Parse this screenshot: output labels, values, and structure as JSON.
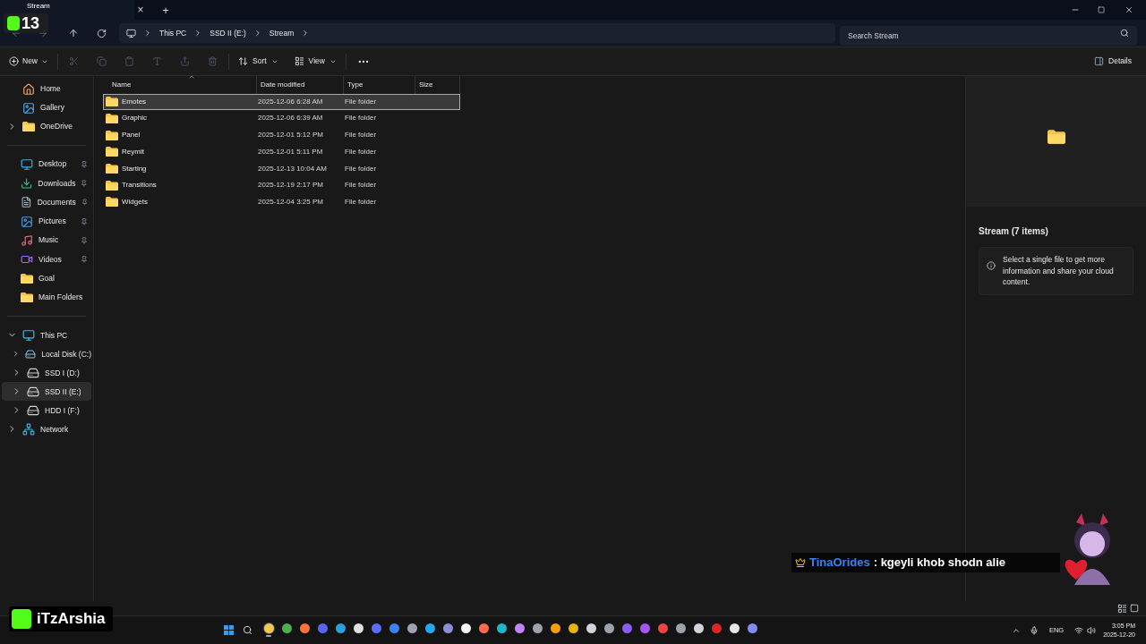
{
  "overlay": {
    "logo_number": "13",
    "streamer": "iTzArshia",
    "chat": {
      "user": "TinaOrides",
      "message": ": kgeyli khob shodn alie"
    }
  },
  "tab": {
    "title": "Stream",
    "close": "×",
    "add": "+"
  },
  "breadcrumb": [
    "This PC",
    "SSD II (E:)",
    "Stream"
  ],
  "search": {
    "placeholder": "Search Stream"
  },
  "toolbar": {
    "new": "New",
    "sort": "Sort",
    "view": "View",
    "details": "Details"
  },
  "sidebar": {
    "top": [
      {
        "label": "Home"
      },
      {
        "label": "Gallery"
      },
      {
        "label": "OneDrive",
        "expanded": false
      }
    ],
    "quick": [
      {
        "label": "Desktop",
        "pinned": true
      },
      {
        "label": "Downloads",
        "pinned": true
      },
      {
        "label": "Documents",
        "pinned": true
      },
      {
        "label": "Pictures",
        "pinned": true
      },
      {
        "label": "Music",
        "pinned": true
      },
      {
        "label": "Videos",
        "pinned": true
      },
      {
        "label": "Goal",
        "pinned": false
      },
      {
        "label": "Main Folders",
        "pinned": false
      }
    ],
    "tree": [
      {
        "label": "This PC",
        "expanded": true,
        "selected": false,
        "children": [
          {
            "label": "Local Disk (C:)",
            "expanded": false,
            "selected": false
          },
          {
            "label": "SSD I (D:)",
            "expanded": false,
            "selected": false
          },
          {
            "label": "SSD II (E:)",
            "expanded": false,
            "selected": true
          },
          {
            "label": "HDD I (F:)",
            "expanded": false,
            "selected": false
          }
        ]
      },
      {
        "label": "Network",
        "expanded": false,
        "selected": false
      }
    ]
  },
  "columns": [
    "Name",
    "Date modified",
    "Type",
    "Size"
  ],
  "rows": [
    {
      "name": "Emotes",
      "date": "2025-12-06 6:28 AM",
      "type": "File folder",
      "selected": true
    },
    {
      "name": "Graphic",
      "date": "2025-12-06 6:39 AM",
      "type": "File folder",
      "selected": false
    },
    {
      "name": "Panel",
      "date": "2025-12-01 5:12 PM",
      "type": "File folder",
      "selected": false
    },
    {
      "name": "Reymit",
      "date": "2025-12-01 5:11 PM",
      "type": "File folder",
      "selected": false
    },
    {
      "name": "Starting",
      "date": "2025-12-13 10:04 AM",
      "type": "File folder",
      "selected": false
    },
    {
      "name": "Transitions",
      "date": "2025-12-19 2:17 PM",
      "type": "File folder",
      "selected": false
    },
    {
      "name": "Widgets",
      "date": "2025-12-04 3:25 PM",
      "type": "File folder",
      "selected": false
    }
  ],
  "details": {
    "title": "Stream (7 items)",
    "info": "Select a single file to get more information and share your cloud content."
  },
  "taskbar": {
    "apps": [
      {
        "color": "#f2c94c",
        "active": true
      },
      {
        "color": "#4caf50",
        "active": false
      },
      {
        "color": "#ff7139",
        "active": false
      },
      {
        "color": "#5865f2",
        "active": false
      },
      {
        "color": "#2aa1de",
        "active": false
      },
      {
        "color": "#e0e0e0",
        "active": false
      },
      {
        "color": "#5b6cff",
        "active": false
      },
      {
        "color": "#3b82f6",
        "active": false
      },
      {
        "color": "#9ca3af",
        "active": false
      },
      {
        "color": "#23a9f2",
        "active": false
      },
      {
        "color": "#8b8fd9",
        "active": false
      },
      {
        "color": "#f5f5f5",
        "active": false
      },
      {
        "color": "#ff6b4a",
        "active": false
      },
      {
        "color": "#1fb6c9",
        "active": false
      },
      {
        "color": "#c084fc",
        "active": false
      },
      {
        "color": "#9ca3af",
        "active": false
      },
      {
        "color": "#f59e0b",
        "active": false
      },
      {
        "color": "#eab308",
        "active": false
      },
      {
        "color": "#d1d5db",
        "active": false
      },
      {
        "color": "#9ca3af",
        "active": false
      },
      {
        "color": "#8b5cf6",
        "active": false
      },
      {
        "color": "#a855f7",
        "active": false
      },
      {
        "color": "#ef4444",
        "active": false
      },
      {
        "color": "#9ca3af",
        "active": false
      },
      {
        "color": "#d1d5db",
        "active": false
      },
      {
        "color": "#dc2626",
        "active": false
      },
      {
        "color": "#e5e7eb",
        "active": false
      },
      {
        "color": "#818cf8",
        "active": false
      }
    ],
    "language": "ENG",
    "time": "3:05 PM",
    "date": "2025-12-20"
  }
}
